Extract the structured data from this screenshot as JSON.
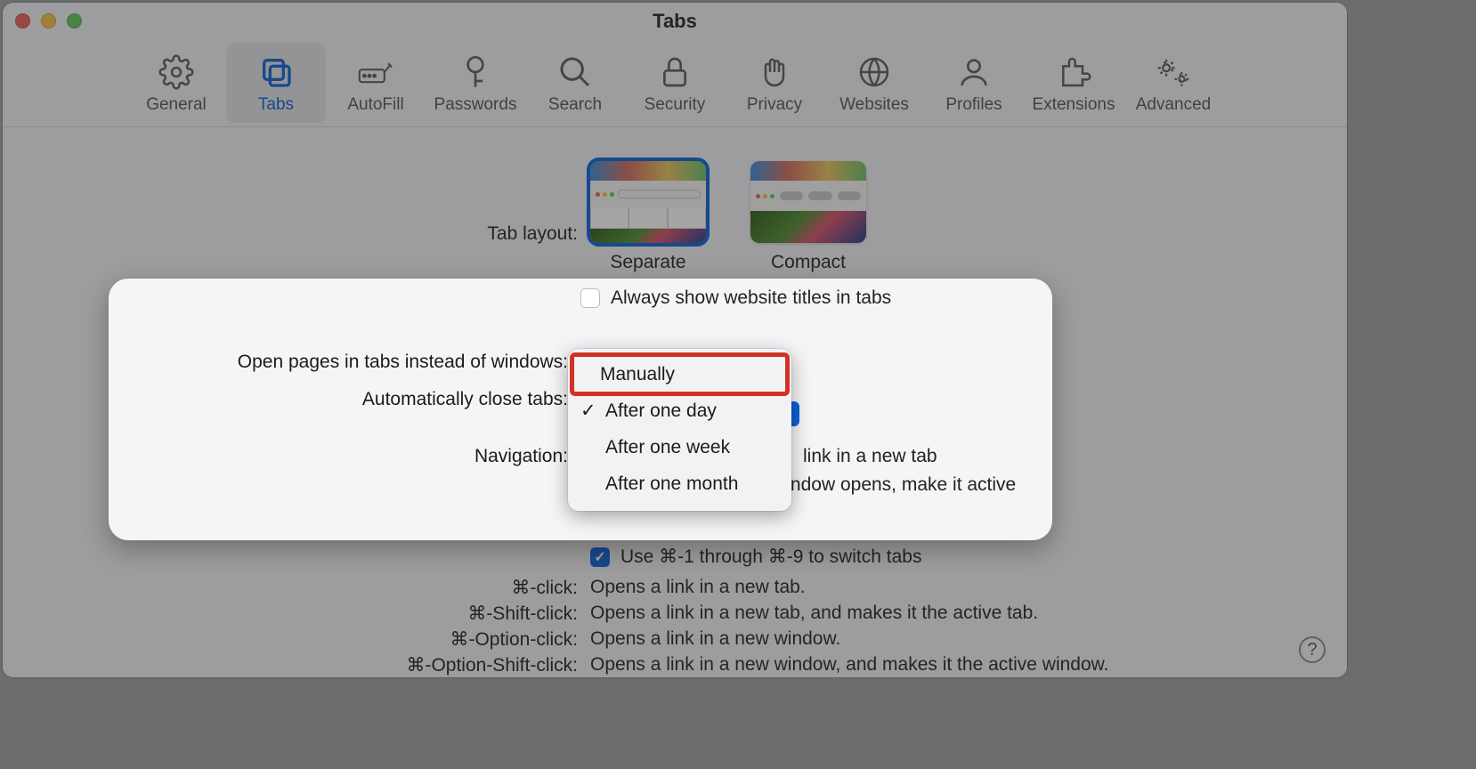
{
  "window": {
    "title": "Tabs"
  },
  "toolbar": {
    "items": [
      {
        "label": "General"
      },
      {
        "label": "Tabs"
      },
      {
        "label": "AutoFill"
      },
      {
        "label": "Passwords"
      },
      {
        "label": "Search"
      },
      {
        "label": "Security"
      },
      {
        "label": "Privacy"
      },
      {
        "label": "Websites"
      },
      {
        "label": "Profiles"
      },
      {
        "label": "Extensions"
      },
      {
        "label": "Advanced"
      }
    ]
  },
  "settings": {
    "tab_layout_label": "Tab layout:",
    "layout_separate": "Separate",
    "layout_compact": "Compact",
    "always_show_titles": "Always show website titles in tabs",
    "open_pages_label": "Open pages in tabs instead of windows:",
    "auto_close_label": "Automatically close tabs:",
    "navigation_label": "Navigation:",
    "nav_partial_text": "link in a new tab",
    "new_tab_active": "When a new tab or window opens, make it active",
    "cmd_switch": "Use ⌘-1 through ⌘-9 to switch tabs"
  },
  "dropdown": {
    "options": [
      "Manually",
      "After one day",
      "After one week",
      "After one month"
    ],
    "selected_index": 1,
    "highlighted_index": 0
  },
  "shortcuts": [
    {
      "key": "⌘-click:",
      "desc": "Opens a link in a new tab."
    },
    {
      "key": "⌘-Shift-click:",
      "desc": "Opens a link in a new tab, and makes it the active tab."
    },
    {
      "key": "⌘-Option-click:",
      "desc": "Opens a link in a new window."
    },
    {
      "key": "⌘-Option-Shift-click:",
      "desc": "Opens a link in a new window, and makes it the active window."
    }
  ],
  "help_glyph": "?"
}
